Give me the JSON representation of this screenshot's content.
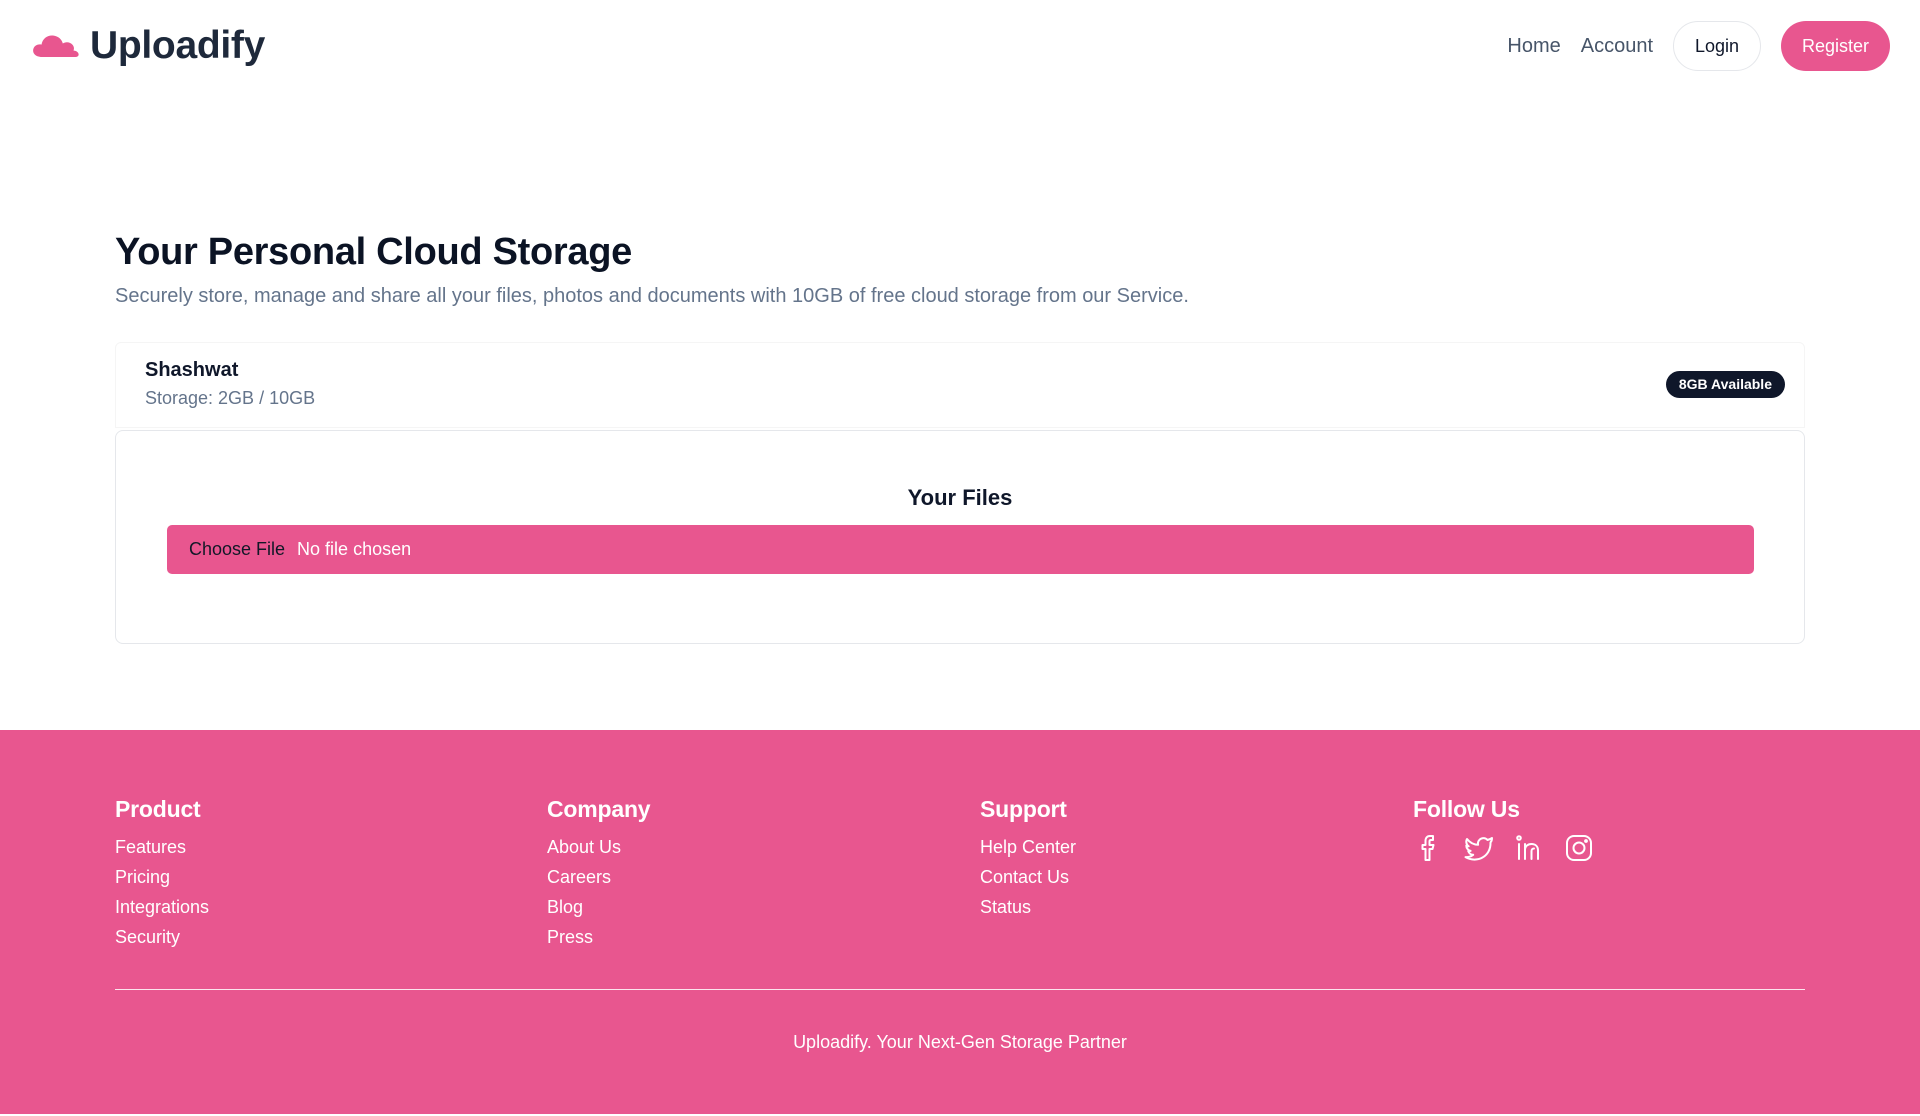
{
  "colors": {
    "brand": "#e8568f",
    "text_dark": "#0f172a",
    "text_muted": "#64748b",
    "badge_bg": "#0f172a"
  },
  "header": {
    "logo_icon": "cloud-icon",
    "brand_name": "Uploadify",
    "nav": {
      "home": "Home",
      "account": "Account"
    },
    "login_label": "Login",
    "register_label": "Register"
  },
  "main": {
    "title": "Your Personal Cloud Storage",
    "subtitle": "Securely store, manage and share all your files, photos and documents with 10GB of free cloud storage from our Service.",
    "user": {
      "name": "Shashwat",
      "storage": "Storage: 2GB / 10GB",
      "badge": "8GB Available"
    },
    "files": {
      "title": "Your Files",
      "choose_label": "Choose File",
      "status": "No file chosen"
    }
  },
  "footer": {
    "product": {
      "heading": "Product",
      "links": [
        "Features",
        "Pricing",
        "Integrations",
        "Security"
      ]
    },
    "company": {
      "heading": "Company",
      "links": [
        "About Us",
        "Careers",
        "Blog",
        "Press"
      ]
    },
    "support": {
      "heading": "Support",
      "links": [
        "Help Center",
        "Contact Us",
        "Status"
      ]
    },
    "follow": {
      "heading": "Follow Us",
      "icons": [
        "facebook-icon",
        "twitter-icon",
        "linkedin-icon",
        "instagram-icon"
      ]
    },
    "tagline": "Uploadify. Your Next-Gen Storage Partner"
  }
}
